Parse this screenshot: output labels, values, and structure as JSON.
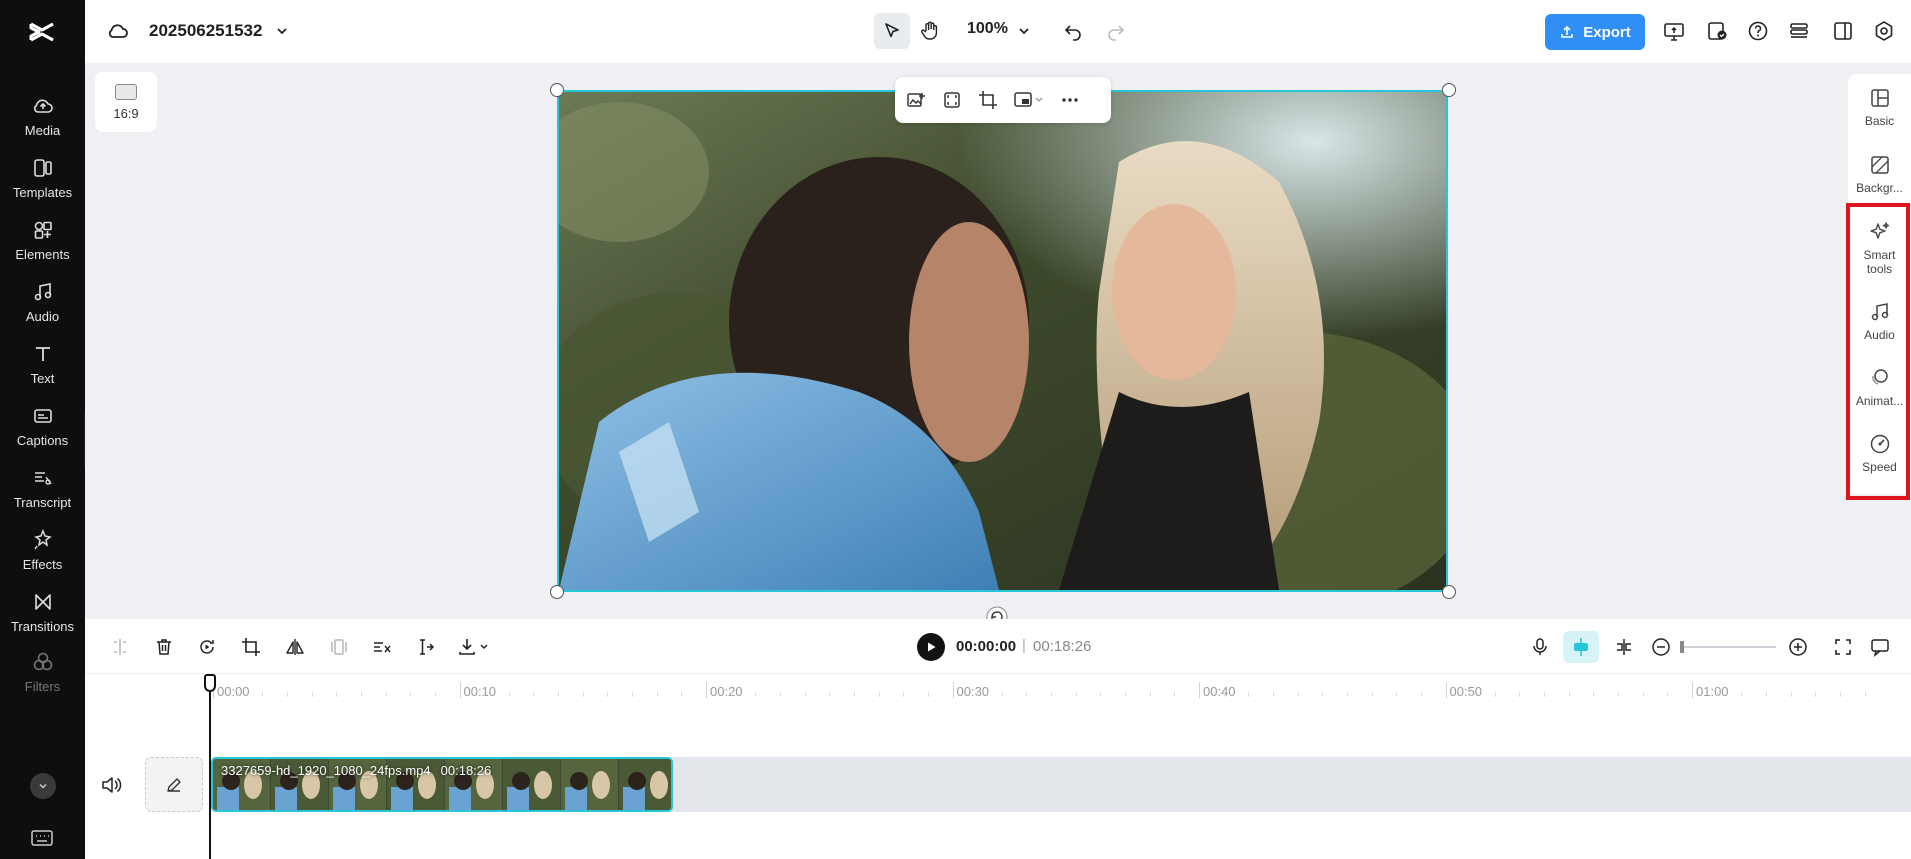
{
  "sidebar": {
    "items": [
      {
        "label": "Media",
        "icon": "cloud-upload-icon"
      },
      {
        "label": "Templates",
        "icon": "templates-icon"
      },
      {
        "label": "Elements",
        "icon": "elements-icon"
      },
      {
        "label": "Audio",
        "icon": "music-note-icon"
      },
      {
        "label": "Text",
        "icon": "text-icon"
      },
      {
        "label": "Captions",
        "icon": "captions-icon"
      },
      {
        "label": "Transcript",
        "icon": "transcript-icon"
      },
      {
        "label": "Effects",
        "icon": "effects-icon"
      },
      {
        "label": "Transitions",
        "icon": "transitions-icon"
      },
      {
        "label": "Filters",
        "icon": "filters-icon"
      }
    ]
  },
  "header": {
    "project_name": "202506251532",
    "zoom": "100%",
    "export_label": "Export"
  },
  "canvas": {
    "ratio_label": "16:9"
  },
  "right_panel": {
    "items": [
      {
        "label": "Basic"
      },
      {
        "label": "Backgr..."
      },
      {
        "label": "Smart tools"
      },
      {
        "label": "Audio"
      },
      {
        "label": "Animat..."
      },
      {
        "label": "Speed"
      }
    ]
  },
  "playback": {
    "current_time": "00:00:00",
    "separator": "|",
    "total_time": "00:18:26"
  },
  "timeline": {
    "ticks": [
      "00:00",
      "00:10",
      "00:20",
      "00:30",
      "00:40",
      "00:50",
      "01:00"
    ],
    "clip": {
      "filename": "3327659-hd_1920_1080_24fps.mp4",
      "duration": "00:18:26"
    }
  },
  "colors": {
    "accent": "#27c5d8",
    "export": "#2f8ff7",
    "highlight": "#e0141e",
    "sidebar_bg": "#0e0e10"
  }
}
